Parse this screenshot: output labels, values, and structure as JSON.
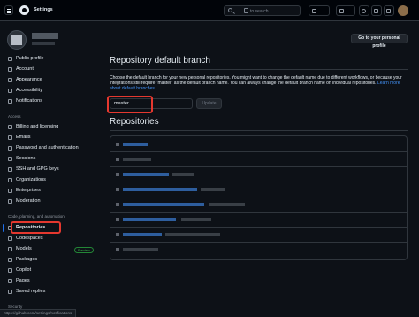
{
  "header": {
    "title": "Settings",
    "search_placeholder": "to search"
  },
  "sidebar": {
    "items": [
      {
        "label": "Public profile",
        "icon": "person-icon"
      },
      {
        "label": "Account",
        "icon": "gear-icon"
      },
      {
        "label": "Appearance",
        "icon": "paintbrush-icon"
      },
      {
        "label": "Accessibility",
        "icon": "accessibility-icon"
      },
      {
        "label": "Notifications",
        "icon": "bell-icon"
      }
    ],
    "access_heading": "Access",
    "access_items": [
      {
        "label": "Billing and licensing",
        "icon": "credit-card-icon"
      },
      {
        "label": "Emails",
        "icon": "mail-icon"
      },
      {
        "label": "Password and authentication",
        "icon": "shield-lock-icon"
      },
      {
        "label": "Sessions",
        "icon": "broadcast-icon"
      },
      {
        "label": "SSH and GPG keys",
        "icon": "key-icon"
      },
      {
        "label": "Organizations",
        "icon": "organization-icon"
      },
      {
        "label": "Enterprises",
        "icon": "globe-icon"
      },
      {
        "label": "Moderation",
        "icon": "report-icon"
      }
    ],
    "code_heading": "Code, planning, and automation",
    "code_items": [
      {
        "label": "Repositories",
        "icon": "repo-icon",
        "active": true
      },
      {
        "label": "Codespaces",
        "icon": "codespaces-icon"
      },
      {
        "label": "Models",
        "icon": "ai-model-icon",
        "badge": "Preview"
      },
      {
        "label": "Packages",
        "icon": "package-icon"
      },
      {
        "label": "Copilot",
        "icon": "copilot-icon"
      },
      {
        "label": "Pages",
        "icon": "browser-icon"
      },
      {
        "label": "Saved replies",
        "icon": "reply-icon"
      }
    ],
    "security_heading": "Security"
  },
  "main": {
    "personal_profile_button": "Go to your personal profile",
    "default_branch": {
      "heading": "Repository default branch",
      "description": "Choose the default branch for your new personal repositories. You might want to change the default name due to different workflows, or because your integrations still require “master” as the default branch name. You can always change the default branch name on individual repositories.",
      "link": "Learn more about default branches.",
      "value": "master",
      "update_label": "Update"
    },
    "repositories_heading": "Repositories"
  },
  "status_bar_url": "https://github.com/settings/notifications",
  "colors": {
    "background": "#0d1117",
    "header": "#010409",
    "accent": "#1f6feb",
    "link": "#4493f8",
    "highlight": "#e5382f"
  }
}
